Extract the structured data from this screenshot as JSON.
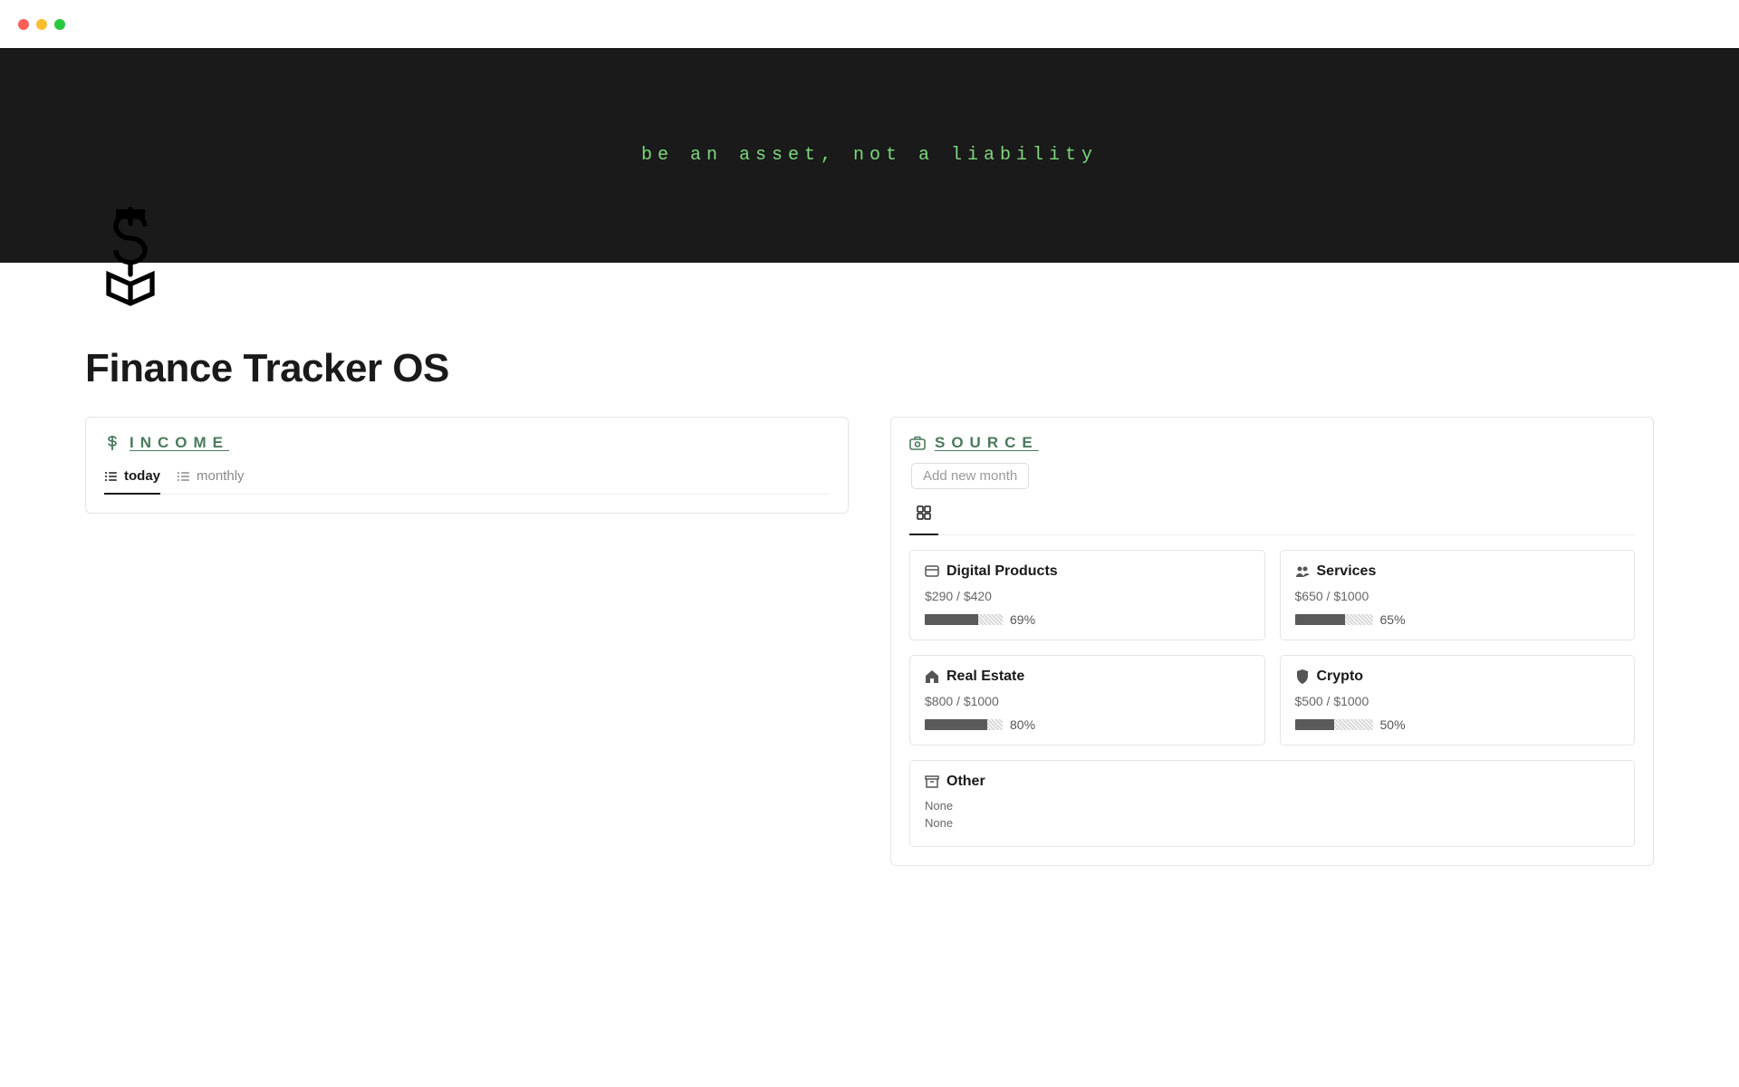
{
  "hero_text": "be an asset, not a liability",
  "page_title": "Finance Tracker OS",
  "income": {
    "title": "INCOME",
    "tabs": [
      {
        "label": "today",
        "active": true
      },
      {
        "label": "monthly",
        "active": false
      }
    ]
  },
  "source": {
    "title": "SOURCE",
    "add_button": "Add new month",
    "items": [
      {
        "icon": "credit-card",
        "name": "Digital Products",
        "amount": "$290 / $420",
        "percent": 69,
        "percent_label": "69%"
      },
      {
        "icon": "people",
        "name": "Services",
        "amount": "$650 / $1000",
        "percent": 65,
        "percent_label": "65%"
      },
      {
        "icon": "home",
        "name": "Real Estate",
        "amount": "$800 / $1000",
        "percent": 80,
        "percent_label": "80%"
      },
      {
        "icon": "shield",
        "name": "Crypto",
        "amount": "$500 / $1000",
        "percent": 50,
        "percent_label": "50%"
      },
      {
        "icon": "archive",
        "name": "Other",
        "none_lines": [
          "None",
          "None"
        ]
      }
    ]
  }
}
